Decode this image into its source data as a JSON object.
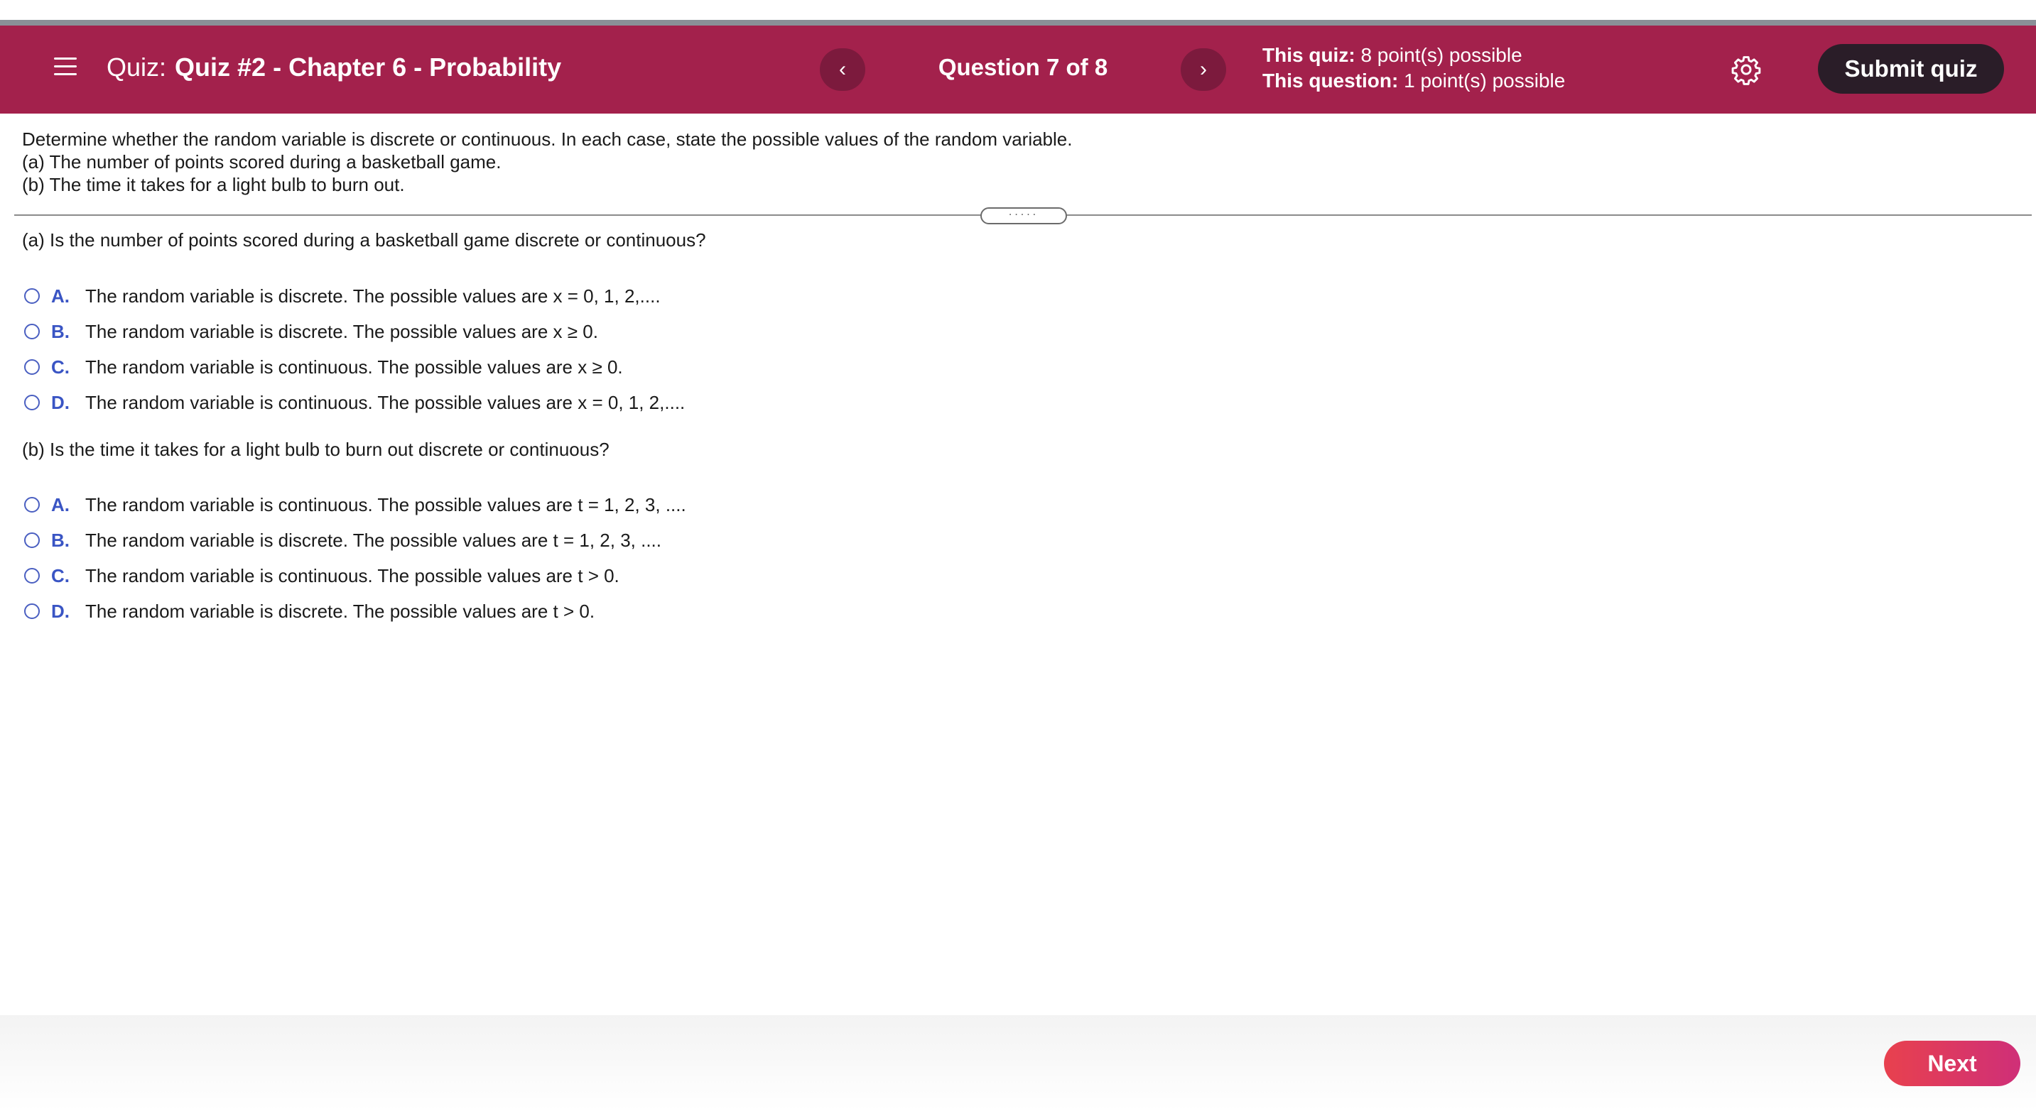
{
  "header": {
    "quiz_prefix": "Quiz:",
    "quiz_name": "Quiz #2 - Chapter 6 - Probability",
    "prev_icon": "‹",
    "next_icon": "›",
    "question_counter": "Question 7 of 8",
    "quiz_points_label": "This quiz:",
    "quiz_points_value": "8 point(s) possible",
    "question_points_label": "This question:",
    "question_points_value": "1 point(s) possible",
    "submit_label": "Submit quiz",
    "settings_icon": "gear-icon",
    "menu_icon": "hamburger-icon"
  },
  "problem": {
    "intro": "Determine whether the random variable is discrete or continuous. In each case, state the possible values of the random variable.",
    "part_a": "(a) The number of points scored during a basketball game.",
    "part_b": "(b) The time it takes for a light bulb to burn out."
  },
  "divider_handle": ".....",
  "question_a": {
    "prompt": "(a) Is the number of points scored during a basketball game discrete or continuous?",
    "options": [
      {
        "letter": "A.",
        "text": "The random variable is discrete. The possible values are x = 0, 1, 2,...."
      },
      {
        "letter": "B.",
        "text": "The random variable is discrete. The possible values are x ≥ 0."
      },
      {
        "letter": "C.",
        "text": "The random variable is continuous. The possible values are x ≥ 0."
      },
      {
        "letter": "D.",
        "text": "The random variable is continuous. The possible values are x = 0, 1, 2,...."
      }
    ]
  },
  "question_b": {
    "prompt": "(b) Is the time it takes for a light bulb to burn out discrete or continuous?",
    "options": [
      {
        "letter": "A.",
        "text": "The random variable is continuous. The possible values are t = 1, 2, 3, ...."
      },
      {
        "letter": "B.",
        "text": "The random variable is discrete. The possible values are t = 1, 2, 3, ...."
      },
      {
        "letter": "C.",
        "text": "The random variable is continuous. The possible values are t > 0."
      },
      {
        "letter": "D.",
        "text": "The random variable is discrete. The possible values are t > 0."
      }
    ]
  },
  "footer": {
    "next_label": "Next"
  },
  "colors": {
    "header_bg": "#a3214c",
    "submit_bg": "#2a1d28",
    "option_letter": "#3a55c4",
    "next_gradient_start": "#e8414e",
    "next_gradient_end": "#cf2f78"
  }
}
